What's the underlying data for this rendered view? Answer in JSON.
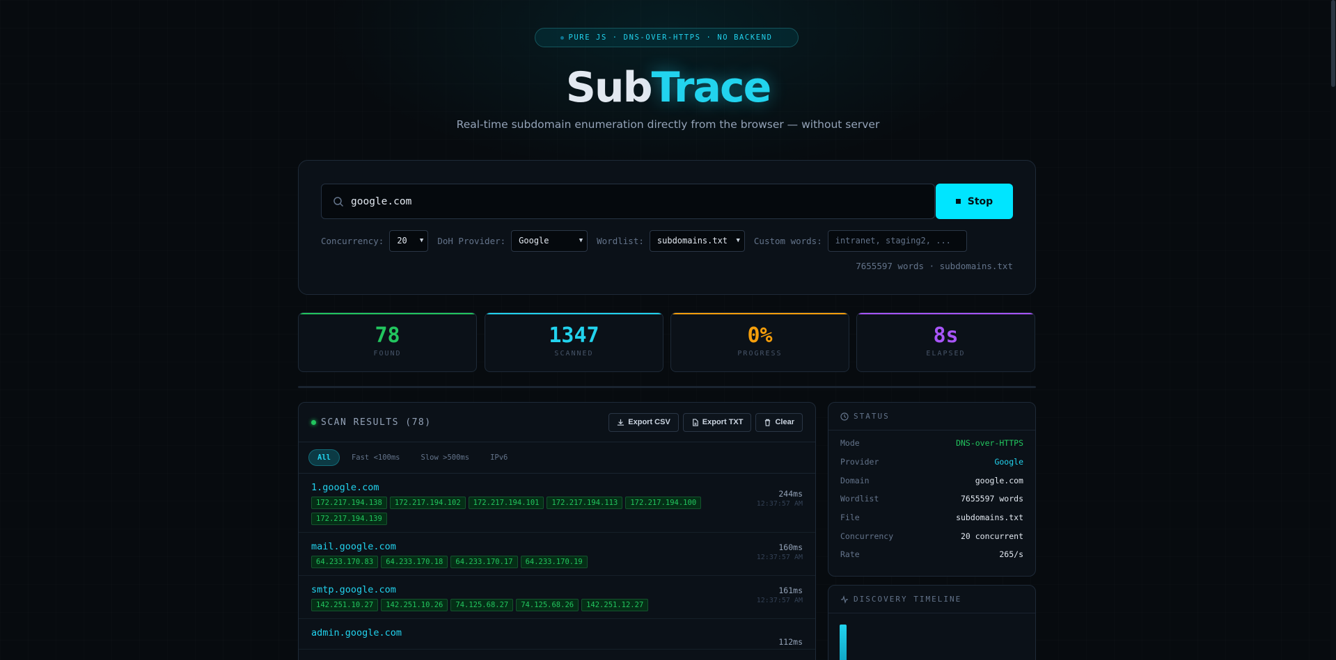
{
  "header": {
    "badge": "PURE JS · DNS-OVER-HTTPS · NO BACKEND",
    "title_part1": "Sub",
    "title_part2": "Trace",
    "subtitle": "Real-time subdomain enumeration directly from the browser — without server"
  },
  "search": {
    "value": "google.com",
    "stop_label": "Stop"
  },
  "options": {
    "concurrency_label": "Concurrency:",
    "concurrency_value": "20",
    "doh_label": "DoH Provider:",
    "doh_value": "Google",
    "wordlist_label": "Wordlist:",
    "wordlist_value": "subdomains.txt",
    "custom_label": "Custom words:",
    "custom_placeholder": "intranet, staging2, ...",
    "word_info": "7655597 words · subdomains.txt"
  },
  "stats": [
    {
      "value": "78",
      "label": "FOUND",
      "color": "#22c55e"
    },
    {
      "value": "1347",
      "label": "SCANNED",
      "color": "#22d3ee"
    },
    {
      "value": "0%",
      "label": "PROGRESS",
      "color": "#f59e0b"
    },
    {
      "value": "8s",
      "label": "ELAPSED",
      "color": "#a855f7"
    }
  ],
  "results": {
    "title": "SCAN RESULTS (78)",
    "export_csv": "Export CSV",
    "export_txt": "Export TXT",
    "clear": "Clear",
    "filters": [
      "All",
      "Fast <100ms",
      "Slow >500ms",
      "IPv6"
    ],
    "rows": [
      {
        "host": "1.google.com",
        "ips": [
          "172.217.194.138",
          "172.217.194.102",
          "172.217.194.101",
          "172.217.194.113",
          "172.217.194.100",
          "172.217.194.139"
        ],
        "ms": "244ms",
        "time": "12:37:57 AM"
      },
      {
        "host": "mail.google.com",
        "ips": [
          "64.233.170.83",
          "64.233.170.18",
          "64.233.170.17",
          "64.233.170.19"
        ],
        "ms": "160ms",
        "time": "12:37:57 AM"
      },
      {
        "host": "smtp.google.com",
        "ips": [
          "142.251.10.27",
          "142.251.10.26",
          "74.125.68.27",
          "74.125.68.26",
          "142.251.12.27"
        ],
        "ms": "161ms",
        "time": "12:37:57 AM"
      },
      {
        "host": "admin.google.com",
        "ips": [],
        "ms": "112ms",
        "time": ""
      }
    ]
  },
  "status": {
    "title": "STATUS",
    "items": [
      {
        "k": "Mode",
        "v": "DNS-over-HTTPS",
        "color": "#22c55e"
      },
      {
        "k": "Provider",
        "v": "Google",
        "color": "#22d3ee"
      },
      {
        "k": "Domain",
        "v": "google.com",
        "color": "#e2e8f0"
      },
      {
        "k": "Wordlist",
        "v": "7655597 words",
        "color": "#e2e8f0"
      },
      {
        "k": "File",
        "v": "subdomains.txt",
        "color": "#e2e8f0"
      },
      {
        "k": "Concurrency",
        "v": "20 concurrent",
        "color": "#e2e8f0"
      },
      {
        "k": "Rate",
        "v": "265/s",
        "color": "#e2e8f0"
      }
    ]
  },
  "timeline": {
    "title": "DISCOVERY TIMELINE"
  }
}
